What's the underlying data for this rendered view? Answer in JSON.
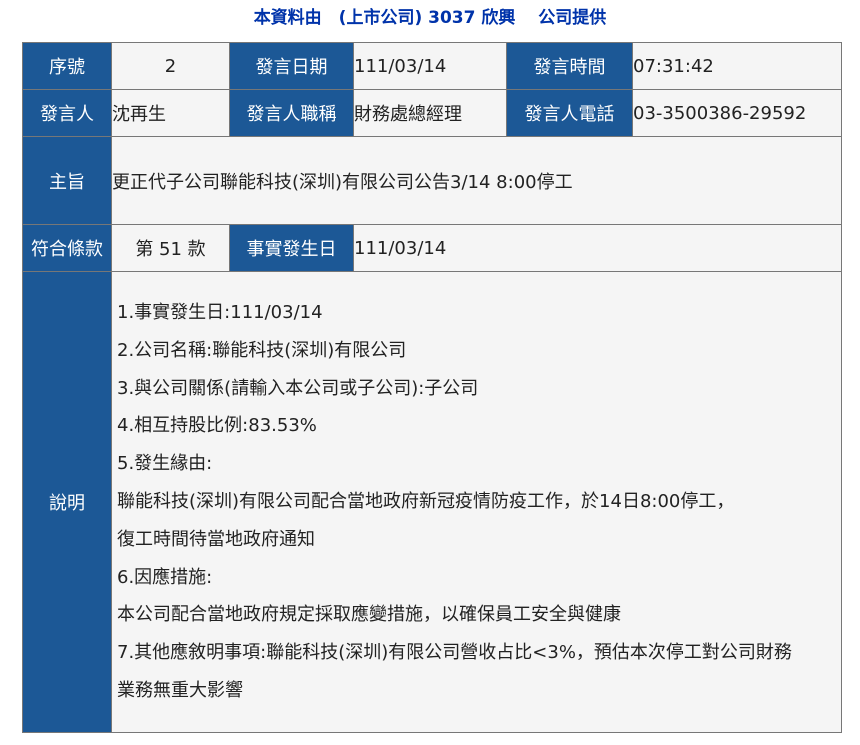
{
  "header": {
    "title": "本資料由　(上市公司) 3037 欣興　 公司提供"
  },
  "row1": {
    "seq_label": "序號",
    "seq_value": "2",
    "date_label": "發言日期",
    "date_value": "111/03/14",
    "time_label": "發言時間",
    "time_value": "07:31:42"
  },
  "row2": {
    "speaker_label": "發言人",
    "speaker_value": "沈再生",
    "title_label": "發言人職稱",
    "title_value": "財務處總經理",
    "phone_label": "發言人電話",
    "phone_value": "03-3500386-29592"
  },
  "subject": {
    "label": "主旨",
    "value": "更正代子公司聯能科技(深圳)有限公司公告3/14 8:00停工"
  },
  "clause": {
    "label": "符合條款",
    "value": "第 51 款",
    "event_date_label": "事實發生日",
    "event_date_value": "111/03/14"
  },
  "description": {
    "label": "說明",
    "lines": [
      "1.事實發生日:111/03/14",
      "2.公司名稱:聯能科技(深圳)有限公司",
      "3.與公司關係(請輸入本公司或子公司):子公司",
      "4.相互持股比例:83.53%",
      "5.發生緣由:",
      "聯能科技(深圳)有限公司配合當地政府新冠疫情防疫工作，於14日8:00停工，",
      "復工時間待當地政府通知",
      "6.因應措施:",
      "本公司配合當地政府規定採取應變措施，以確保員工安全與健康",
      "7.其他應敘明事項:聯能科技(深圳)有限公司營收占比<3%，預估本次停工對公司財務",
      "業務無重大影響"
    ]
  },
  "colors": {
    "label_bg": "#1c5896",
    "value_bg": "#f5f5f5",
    "header_text": "#0033aa",
    "border": "#777777"
  }
}
